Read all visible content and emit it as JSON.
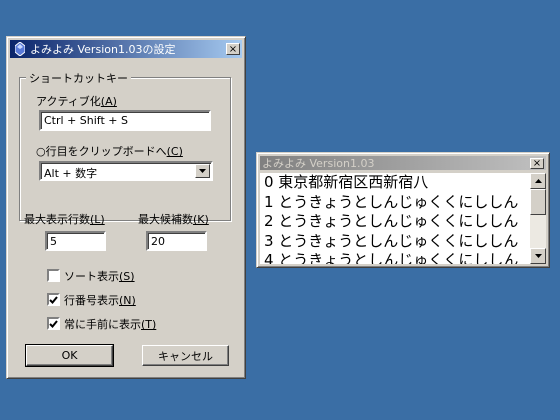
{
  "settings_dialog": {
    "title": "よみよみ Version1.03の設定",
    "close_glyph": "×",
    "shortcut_group": {
      "legend": "ショートカットキー",
      "active_label": "アクティブ化",
      "active_accel": "(A)",
      "active_value": "Ctrl + Shift + S",
      "clipboard_label": "○行目をクリップボードへ",
      "clipboard_accel": "(C)",
      "clipboard_value": "Alt + 数字"
    },
    "max_rows_label": "最大表示行数",
    "max_rows_accel": "(L)",
    "max_rows_value": "5",
    "max_candidates_label": "最大候補数",
    "max_candidates_accel": "(K)",
    "max_candidates_value": "20",
    "checkboxes": [
      {
        "label": "ソート表示",
        "accel": "(S)",
        "checked": false
      },
      {
        "label": "行番号表示",
        "accel": "(N)",
        "checked": true
      },
      {
        "label": "常に手前に表示",
        "accel": "(T)",
        "checked": true
      }
    ],
    "ok_label": "OK",
    "cancel_label": "キャンセル"
  },
  "candidate_window": {
    "title": "よみよみ Version1.03",
    "close_glyph": "×",
    "rows": [
      "0 東京都新宿区西新宿八",
      "1 とうきょうとしんじゅくくにししん",
      "2 とうきょうとしんじゅくくにししん",
      "3 とうきょうとしんじゅくくにししん",
      "4 とうきょうとしんじゅくくにししん"
    ]
  },
  "colors": {
    "desktop": "#3a6ea5",
    "active_title": "#0a246a",
    "inactive_title": "#808080",
    "face": "#d4d0c8"
  }
}
